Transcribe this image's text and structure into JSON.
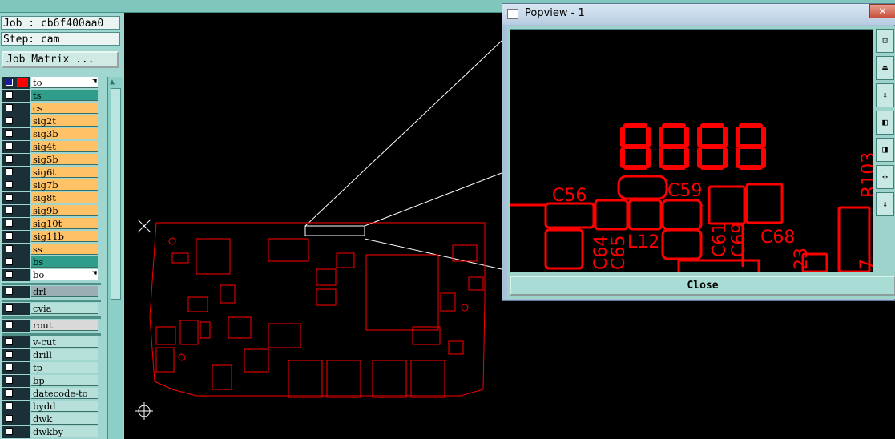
{
  "job": {
    "label": "Job : cb6f400aa0"
  },
  "step": {
    "label": "Step: cam"
  },
  "job_matrix_button": "Job Matrix ...",
  "layers": [
    {
      "name": "to",
      "color": "#ffffff",
      "active": true
    },
    {
      "name": "ts",
      "color": "#2e9e8a"
    },
    {
      "name": "cs",
      "color": "#ffc266"
    },
    {
      "name": "sig2t",
      "color": "#ffc266"
    },
    {
      "name": "sig3b",
      "color": "#ffc266"
    },
    {
      "name": "sig4t",
      "color": "#ffc266"
    },
    {
      "name": "sig5b",
      "color": "#ffc266"
    },
    {
      "name": "sig6t",
      "color": "#ffc266"
    },
    {
      "name": "sig7b",
      "color": "#ffc266"
    },
    {
      "name": "sig8t",
      "color": "#ffc266"
    },
    {
      "name": "sig9b",
      "color": "#ffc266"
    },
    {
      "name": "sig10t",
      "color": "#ffc266"
    },
    {
      "name": "sig11b",
      "color": "#ffc266"
    },
    {
      "name": "ss",
      "color": "#ffc266"
    },
    {
      "name": "bs",
      "color": "#2e9e8a"
    },
    {
      "name": "bo",
      "color": "#ffffff"
    },
    {
      "name": "drl",
      "color": "#9aaeb4"
    },
    {
      "name": "cvia",
      "color": "#b8e0da"
    },
    {
      "name": "rout",
      "color": "#d9d9d9"
    },
    {
      "name": "v-cut",
      "color": "#b8e0da"
    },
    {
      "name": "drill",
      "color": "#b8e0da"
    },
    {
      "name": "tp",
      "color": "#b8e0da"
    },
    {
      "name": "bp",
      "color": "#b8e0da"
    },
    {
      "name": "datecode-to",
      "color": "#b8e0da"
    },
    {
      "name": "bydd",
      "color": "#b8e0da"
    },
    {
      "name": "dwk",
      "color": "#b8e0da"
    },
    {
      "name": "dwkby",
      "color": "#b8e0da"
    }
  ],
  "popview": {
    "title": "Popview - 1",
    "close_label": "Close",
    "silkscreen": [
      "C56",
      "C59",
      "L12",
      "C64",
      "C65",
      "C61",
      "C69",
      "C68",
      "R103",
      "23",
      "7"
    ]
  },
  "colors": {
    "pcb": "#ff0000",
    "panel": "#9fd6cf",
    "accent": "#2e9e8a"
  }
}
